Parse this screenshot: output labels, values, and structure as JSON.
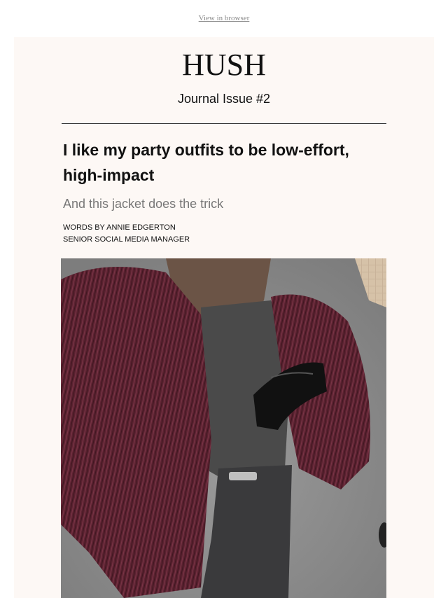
{
  "header": {
    "view_in_browser": "View in browser"
  },
  "masthead": {
    "logo": "HUSH",
    "issue": "Journal Issue #2"
  },
  "article": {
    "headline": "I like my party outfits to be low-effort, high-impact",
    "subhead": "And this jacket does the trick",
    "byline_line1": "WORDS BY ANNIE EDGERTON",
    "byline_line2": "SENIOR SOCIAL MEDIA MANAGER"
  },
  "colors": {
    "card_background": "#fdf8f5",
    "jacket": "#5a2230",
    "headline_text": "#111111",
    "subhead_text": "#777777"
  }
}
